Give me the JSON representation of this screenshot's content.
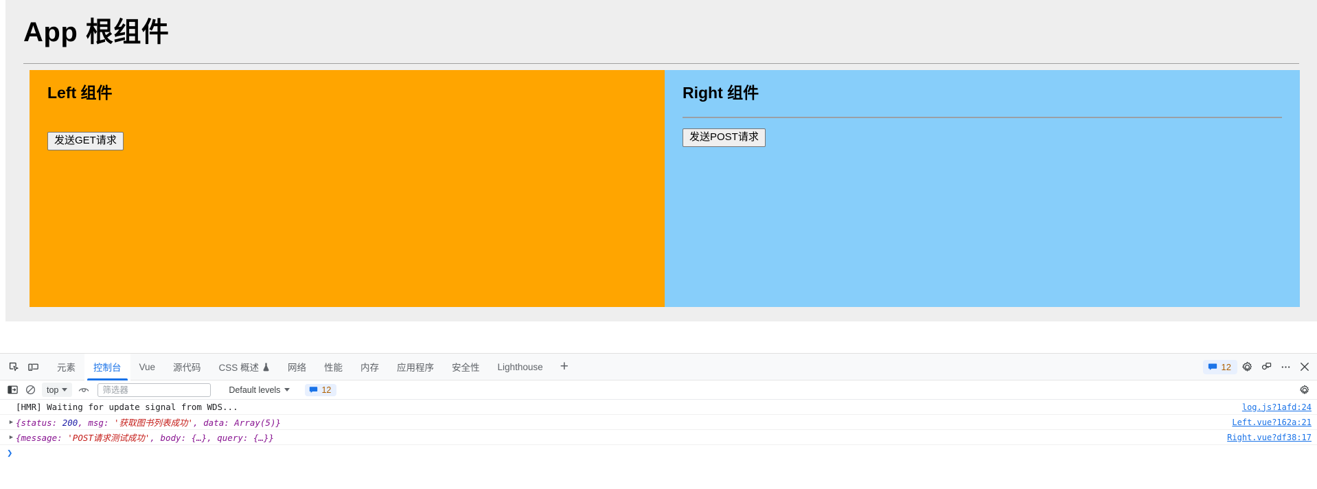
{
  "page": {
    "title": "App 根组件",
    "left_panel": {
      "title": "Left 组件",
      "button_label": "发送GET请求",
      "bg_color": "#ffa500"
    },
    "right_panel": {
      "title": "Right 组件",
      "button_label": "发送POST请求",
      "bg_color": "#87cefa"
    },
    "container_bg": "#eeeeee"
  },
  "devtools": {
    "accent_color": "#1a73e8",
    "left_icons": [
      {
        "name": "inspect-element-icon",
        "title": "检查元素"
      },
      {
        "name": "device-toolbar-icon",
        "title": "设备工具栏"
      }
    ],
    "tabs": [
      {
        "label": "元素",
        "active": false,
        "experimental": false
      },
      {
        "label": "控制台",
        "active": true,
        "experimental": false
      },
      {
        "label": "Vue",
        "active": false,
        "experimental": false
      },
      {
        "label": "源代码",
        "active": false,
        "experimental": false
      },
      {
        "label": "CSS 概述",
        "active": false,
        "experimental": true
      },
      {
        "label": "网络",
        "active": false,
        "experimental": false
      },
      {
        "label": "性能",
        "active": false,
        "experimental": false
      },
      {
        "label": "内存",
        "active": false,
        "experimental": false
      },
      {
        "label": "应用程序",
        "active": false,
        "experimental": false
      },
      {
        "label": "安全性",
        "active": false,
        "experimental": false
      },
      {
        "label": "Lighthouse",
        "active": false,
        "experimental": false
      }
    ],
    "add_tab_label": "+",
    "message_count": "12",
    "right_icons": [
      {
        "name": "settings-gear-icon"
      },
      {
        "name": "feedback-icon"
      },
      {
        "name": "more-options-icon"
      },
      {
        "name": "close-devtools-icon"
      }
    ],
    "filterbar": {
      "sidebar_toggle_name": "console-sidebar-toggle-icon",
      "clear_console_name": "clear-console-icon",
      "context_value": "top",
      "live_expression_name": "live-expression-eye-icon",
      "filter_placeholder": "筛选器",
      "filter_value": "",
      "levels_label": "Default levels",
      "message_count": "12",
      "settings_name": "console-settings-gear-icon"
    },
    "console_rows": [
      {
        "expandable": false,
        "kind": "plain",
        "text": "[HMR] Waiting for update signal from WDS...",
        "source": "log.js?1afd:24"
      },
      {
        "expandable": true,
        "kind": "object",
        "prefix": "{status: ",
        "number": "200",
        "mid": ", msg: ",
        "string": "'获取图书列表成功'",
        "suffix": ", data: Array(5)}",
        "text": "{status: 200, msg: '获取图书列表成功', data: Array(5)}",
        "source": "Left.vue?162a:21"
      },
      {
        "expandable": true,
        "kind": "object",
        "prefix": "{message: ",
        "number": "",
        "mid": "",
        "string": "'POST请求测试成功'",
        "suffix": ", body: {…}, query: {…}}",
        "text": "{message: 'POST请求测试成功', body: {…}, query: {…}}",
        "source": "Right.vue?df38:17"
      }
    ],
    "prompt_symbol": "❯"
  }
}
